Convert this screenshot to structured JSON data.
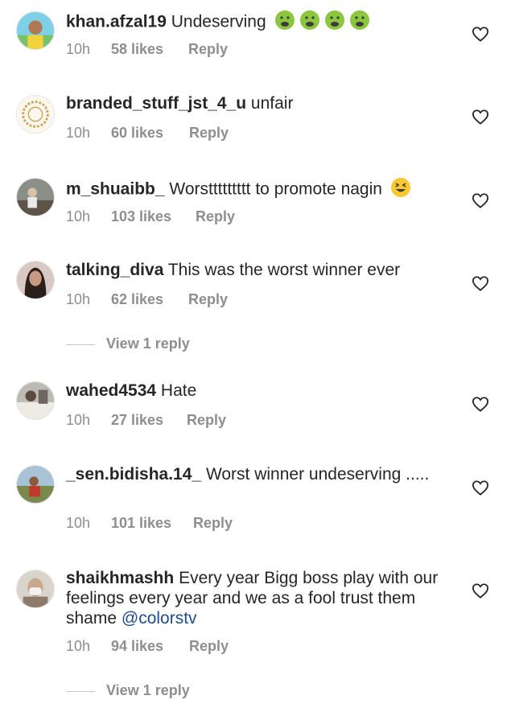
{
  "comments": [
    {
      "username": "khan.afzal19",
      "text": "Undeserving",
      "time": "10h",
      "likes": "58 likes",
      "reply": "Reply",
      "emoji": "nauseated-face x4"
    },
    {
      "username": "branded_stuff_jst_4_u",
      "text": "unfair",
      "time": "10h",
      "likes": "60 likes",
      "reply": "Reply"
    },
    {
      "username": "m_shuaibb_",
      "text": "Worsttttttttt to promote nagin",
      "time": "10h",
      "likes": "103 likes",
      "reply": "Reply",
      "emoji": "grinning-squinting-face"
    },
    {
      "username": "talking_diva",
      "text": "This was the worst winner ever",
      "time": "10h",
      "likes": "62 likes",
      "reply": "Reply"
    },
    {
      "username": "wahed4534",
      "text": "Hate",
      "time": "10h",
      "likes": "27 likes",
      "reply": "Reply"
    },
    {
      "username": "_sen.bidisha.14_",
      "text": "Worst winner undeserving .....",
      "time": "10h",
      "likes": "101 likes",
      "reply": "Reply"
    },
    {
      "username": "shaikhmashh",
      "text": "Every year Bigg boss play with our feelings every year and we as a fool trust them shame",
      "mention": "@colorstv",
      "time": "10h",
      "likes": "94 likes",
      "reply": "Reply"
    }
  ],
  "view_replies": [
    "View 1 reply",
    "View 1 reply"
  ],
  "colors": {
    "text": "#262626",
    "meta": "#8e8e8e",
    "mention": "#1f4b8e",
    "heart": "#262626"
  }
}
